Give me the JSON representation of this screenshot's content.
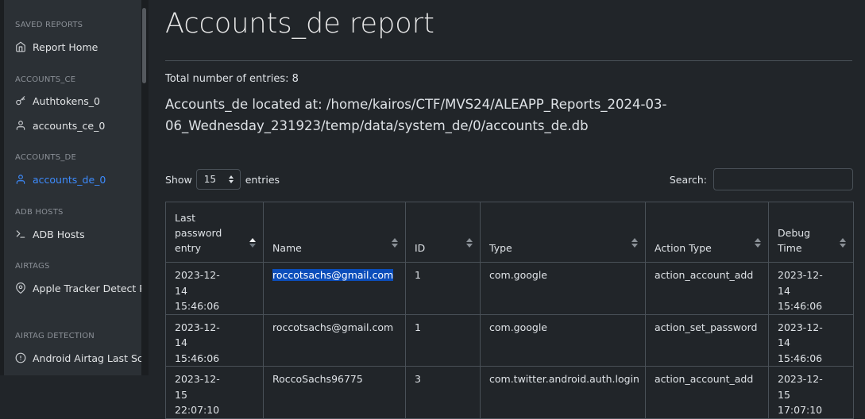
{
  "sidebar": {
    "sections": [
      {
        "heading": "SAVED REPORTS",
        "items": [
          {
            "label": "Report Home",
            "icon": "home-icon"
          }
        ]
      },
      {
        "heading": "ACCOUNTS_CE",
        "items": [
          {
            "label": "Authtokens_0",
            "icon": "key-icon"
          },
          {
            "label": "accounts_ce_0",
            "icon": "user-icon"
          }
        ]
      },
      {
        "heading": "ACCOUNTS_DE",
        "items": [
          {
            "label": "accounts_de_0",
            "icon": "user-icon",
            "active": true
          }
        ]
      },
      {
        "heading": "ADB HOSTS",
        "items": [
          {
            "label": "ADB Hosts",
            "icon": "terminal-icon"
          }
        ]
      },
      {
        "heading": "AIRTAGS",
        "items": [
          {
            "label": "Apple Tracker Detect Pre",
            "icon": "map-pin-icon"
          }
        ]
      },
      {
        "heading": "AIRTAG DETECTION",
        "items": [
          {
            "label": "Android Airtag Last Scan",
            "icon": "alert-circle-icon"
          }
        ]
      }
    ]
  },
  "main": {
    "title": "Accounts_de report",
    "total_entries": "Total number of entries: 8",
    "located_at": "Accounts_de located at: /home/kairos/CTF/MVS24/ALEAPP_Reports_2024-03-06_Wednesday_231923/temp/data/system_de/0/accounts_de.db",
    "show_label": "Show",
    "entries_label": "entries",
    "page_length": "15",
    "search_label": "Search:",
    "search_value": ""
  },
  "table": {
    "columns": [
      "Last password entry",
      "Name",
      "ID",
      "Type",
      "Action Type",
      "Debug Time"
    ],
    "rows": [
      [
        "2023-12-14 15:46:06",
        "roccotsachs@gmail.com",
        "1",
        "com.google",
        "action_account_add",
        "2023-12-14 15:46:06"
      ],
      [
        "2023-12-14 15:46:06",
        "roccotsachs@gmail.com",
        "1",
        "com.google",
        "action_set_password",
        "2023-12-14 15:46:06"
      ],
      [
        "2023-12-15 22:07:10",
        "RoccoSachs96775",
        "3",
        "com.twitter.android.auth.login",
        "action_account_add",
        "2023-12-15 17:07:10"
      ]
    ]
  },
  "colors": {
    "background": "#212529",
    "sidebar": "#2b3035",
    "active_link": "#3d8bfd",
    "text_highlight": "#0b4dba"
  }
}
